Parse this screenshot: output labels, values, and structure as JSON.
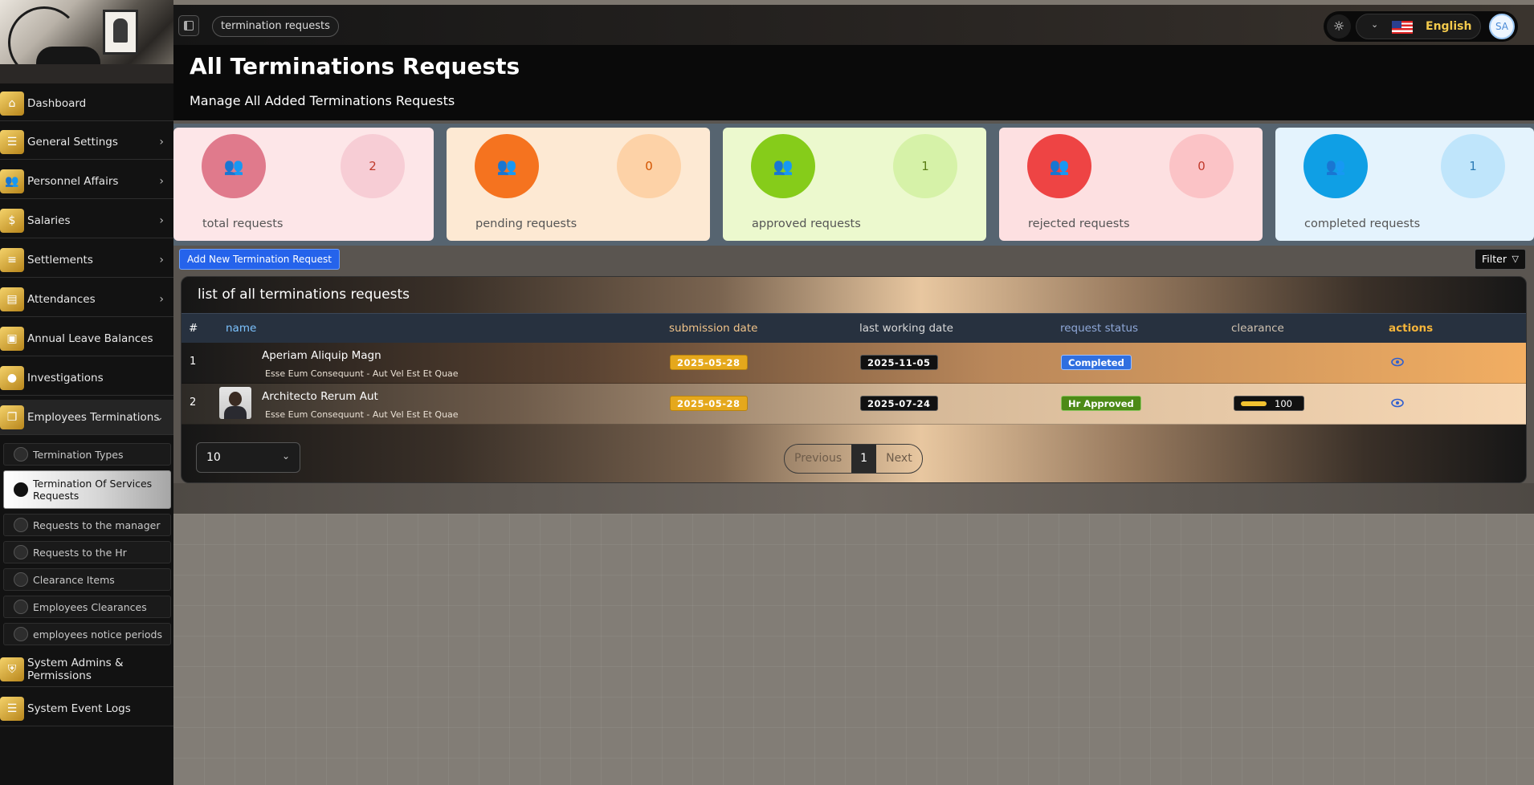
{
  "sidebar": {
    "items": [
      {
        "label": "Dashboard",
        "icon": "home-icon",
        "chevron": false
      },
      {
        "label": "General Settings",
        "icon": "sliders-icon",
        "chevron": true
      },
      {
        "label": "Personnel Affairs",
        "icon": "users-icon",
        "chevron": true
      },
      {
        "label": "Salaries",
        "icon": "salary-icon",
        "chevron": true
      },
      {
        "label": "Settlements",
        "icon": "list-icon",
        "chevron": true
      },
      {
        "label": "Attendances",
        "icon": "layers-icon",
        "chevron": true
      },
      {
        "label": "Annual Leave Balances",
        "icon": "bag-icon",
        "chevron": false
      },
      {
        "label": "Investigations",
        "icon": "circle-icon",
        "chevron": false
      },
      {
        "label": "Employees Terminations",
        "icon": "copy-icon",
        "chevron": true,
        "open": true
      },
      {
        "label": "System Admins & Permissions",
        "icon": "shield-icon",
        "chevron": false
      },
      {
        "label": "System Event Logs",
        "icon": "menu-icon",
        "chevron": false
      }
    ],
    "sub_items": [
      {
        "label": "Termination Types",
        "active": false
      },
      {
        "label": "Termination Of Services Requests",
        "active": true
      },
      {
        "label": "Requests to the manager",
        "active": false
      },
      {
        "label": "Requests to the Hr",
        "active": false
      },
      {
        "label": "Clearance Items",
        "active": false
      },
      {
        "label": "Employees Clearances",
        "active": false
      },
      {
        "label": "employees notice periods",
        "active": false
      }
    ]
  },
  "topbar": {
    "breadcrumb": "termination requests",
    "language": "English",
    "flag_icon": "us-flag-icon",
    "user_initials": "SA"
  },
  "header": {
    "title": "All Terminations Requests",
    "subtitle": "Manage All Added Terminations Requests"
  },
  "stats": [
    {
      "label": "total requests",
      "value": "2",
      "bg": "#fde6e8",
      "icon_bg": "#e07a8c",
      "value_bg": "#f7cdd5",
      "value_color": "#c0392b"
    },
    {
      "label": "pending requests",
      "value": "0",
      "bg": "#fde9d3",
      "icon_bg": "#f5731f",
      "value_bg": "#fdd2a7",
      "value_color": "#d35400"
    },
    {
      "label": "approved requests",
      "value": "1",
      "bg": "#ecf9ce",
      "icon_bg": "#86cc1a",
      "value_bg": "#d6f2a8",
      "value_color": "#5a7d14"
    },
    {
      "label": "rejected requests",
      "value": "0",
      "bg": "#fde0e1",
      "icon_bg": "#ee4444",
      "value_bg": "#fbc3c6",
      "value_color": "#c0392b"
    },
    {
      "label": "completed requests",
      "value": "1",
      "bg": "#e4f3fd",
      "icon_bg": "#0f9fe5",
      "value_bg": "#bfe5fb",
      "value_color": "#2b7bb5"
    }
  ],
  "actions": {
    "add_label": "Add New Termination Request",
    "filter_label": "Filter"
  },
  "table": {
    "title": "list of all terminations requests",
    "headers": {
      "index": "#",
      "name": "name",
      "submission": "submission date",
      "last_working": "last working date",
      "status": "request status",
      "clearance": "clearance",
      "actions": "actions"
    },
    "rows": [
      {
        "index": "1",
        "name": "Aperiam Aliquip Magn",
        "sub": "Esse Eum Consequunt - Aut Vel Est Et Quae",
        "submission": "2025-05-28",
        "last_working": "2025-11-05",
        "status": "Completed",
        "clearance": "",
        "has_photo": false
      },
      {
        "index": "2",
        "name": "Architecto Rerum Aut",
        "sub": "Esse Eum Consequunt - Aut Vel Est Et Quae",
        "submission": "2025-05-28",
        "last_working": "2025-07-24",
        "status": "Hr Approved",
        "clearance": "100",
        "has_photo": true
      }
    ],
    "per_page": "10",
    "pager": {
      "prev": "Previous",
      "current": "1",
      "next": "Next"
    }
  }
}
